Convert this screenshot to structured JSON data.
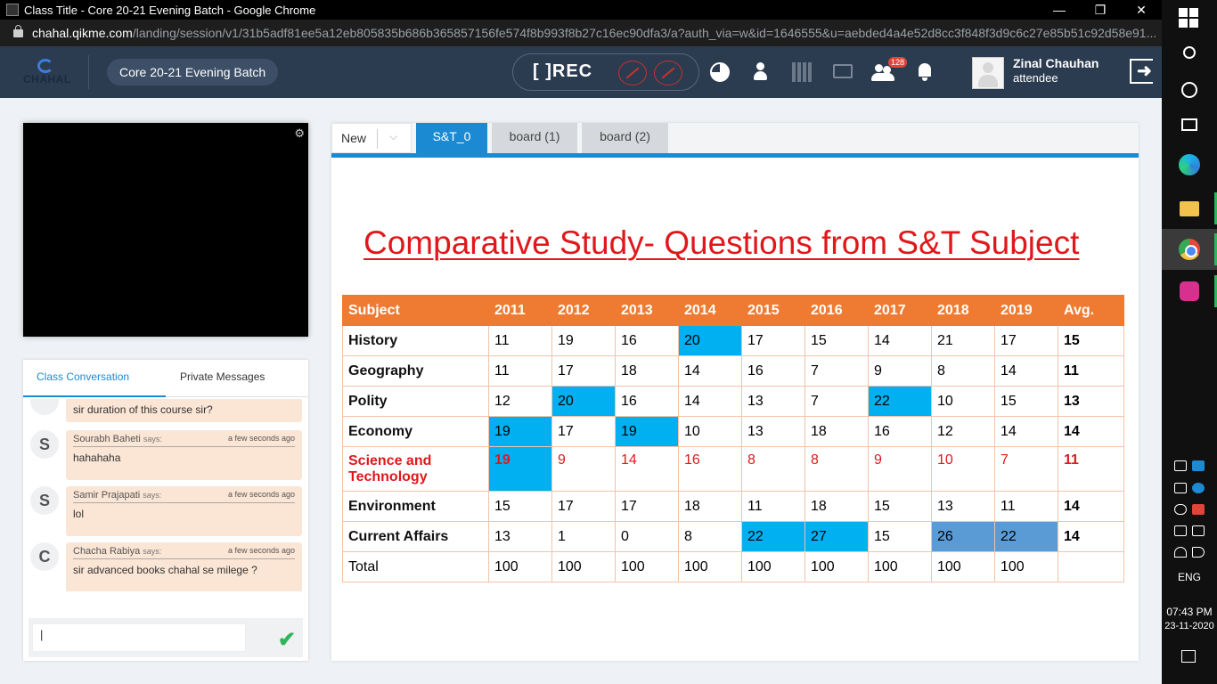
{
  "browser": {
    "title": "Class Title - Core 20-21 Evening Batch - Google Chrome",
    "url_host": "chahal.qikme.com",
    "url_path": "/landing/session/v1/31b5adf81ee5a12eb805835b686b365857156fe574f8b993f8b27c16ec90dfa3/a?auth_via=w&id=1646555&u=aebded4a4e52d8cc3f848f3d9c6c27e85b51c92d58e91...",
    "minimize": "—",
    "restore": "❐",
    "close": "✕"
  },
  "header": {
    "logo_text": "CHAHAL",
    "batch_name": "Core 20-21 Evening Batch",
    "rec_label": "[ ]REC",
    "participants_badge": "128",
    "user_name": "Zinal Chauhan",
    "user_role": "attendee"
  },
  "chat": {
    "tabs": [
      "Class Conversation",
      "Private Messages"
    ],
    "messages": [
      {
        "initial": "",
        "name": "",
        "time": "",
        "text": "sir duration of this course sir?"
      },
      {
        "initial": "S",
        "name": "Sourabh Baheti",
        "says": "says:",
        "time": "a few seconds ago",
        "text": "hahahaha"
      },
      {
        "initial": "S",
        "name": "Samir Prajapati",
        "says": "says:",
        "time": "a few seconds ago",
        "text": "lol"
      },
      {
        "initial": "C",
        "name": "Chacha Rabiya",
        "says": "says:",
        "time": "a few seconds ago",
        "text": "sir advanced books chahal se milege ?"
      }
    ],
    "input_value": "|",
    "send_icon": "✔"
  },
  "board": {
    "new_label": "New",
    "tabs": [
      {
        "label": "S&T_0",
        "active": true
      },
      {
        "label": "board (1)",
        "active": false
      },
      {
        "label": "board (2)",
        "active": false
      }
    ],
    "slide_title": "Comparative Study- Questions from S&T Subject",
    "table": {
      "headers": [
        "Subject",
        "2011",
        "2012",
        "2013",
        "2014",
        "2015",
        "2016",
        "2017",
        "2018",
        "2019",
        "Avg."
      ],
      "rows": [
        {
          "subject": "History",
          "values": [
            "11",
            "19",
            "16",
            "20",
            "17",
            "15",
            "14",
            "21",
            "17"
          ],
          "avg": "15"
        },
        {
          "subject": "Geography",
          "values": [
            "11",
            "17",
            "18",
            "14",
            "16",
            "7",
            "9",
            "8",
            "14"
          ],
          "avg": "11"
        },
        {
          "subject": "Polity",
          "values": [
            "12",
            "20",
            "16",
            "14",
            "13",
            "7",
            "22",
            "10",
            "15"
          ],
          "avg": "13"
        },
        {
          "subject": "Economy",
          "values": [
            "19",
            "17",
            "19",
            "10",
            "13",
            "18",
            "16",
            "12",
            "14"
          ],
          "avg": "14"
        },
        {
          "subject": "Science and Technology",
          "values": [
            "19",
            "9",
            "14",
            "16",
            "8",
            "8",
            "9",
            "10",
            "7"
          ],
          "avg": "11"
        },
        {
          "subject": "Environment",
          "values": [
            "15",
            "17",
            "17",
            "18",
            "11",
            "18",
            "15",
            "13",
            "11"
          ],
          "avg": "14"
        },
        {
          "subject": "Current Affairs",
          "values": [
            "13",
            "1",
            "0",
            "8",
            "22",
            "27",
            "15",
            "26",
            "22"
          ],
          "avg": "14"
        },
        {
          "subject": "Total",
          "values": [
            "100",
            "100",
            "100",
            "100",
            "100",
            "100",
            "100",
            "100",
            "100"
          ],
          "avg": ""
        }
      ]
    }
  },
  "taskbar": {
    "language": "ENG",
    "time": "07:43 PM",
    "date": "23-11-2020"
  },
  "colors": {
    "header_bg": "#2b3b50",
    "accent_blue": "#1b8ad3",
    "table_header": "#ee7b31",
    "highlight_cyan": "#00b0f0",
    "highlight_blue": "#5b9bd5",
    "slide_red": "#e0181b"
  }
}
